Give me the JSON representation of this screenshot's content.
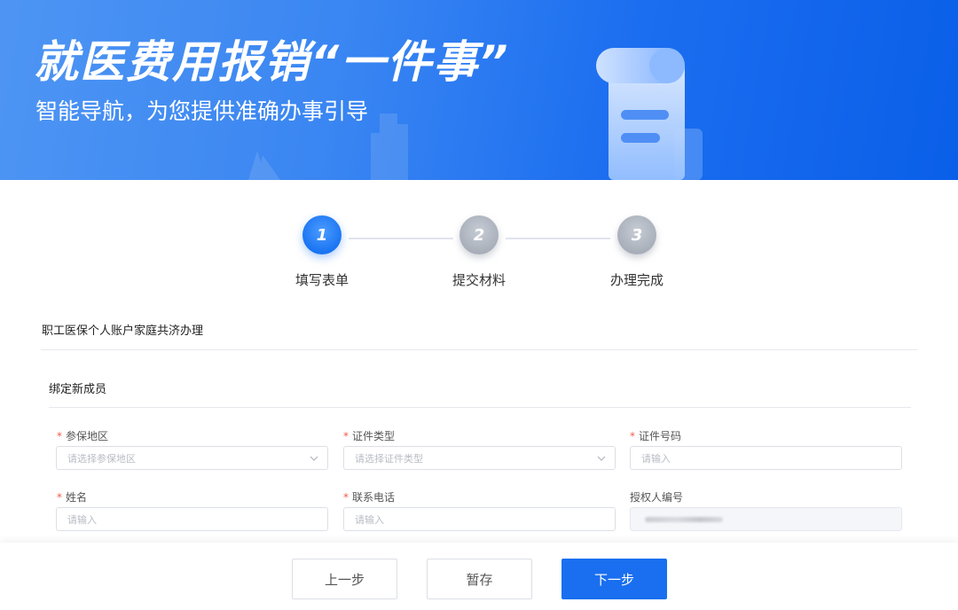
{
  "banner": {
    "title": "就医费用报销“一件事”",
    "subtitle": "智能导航，为您提供准确办事引导"
  },
  "steps": [
    {
      "number": "1",
      "label": "填写表单",
      "state": "active"
    },
    {
      "number": "2",
      "label": "提交材料",
      "state": "inactive"
    },
    {
      "number": "3",
      "label": "办理完成",
      "state": "inactive"
    }
  ],
  "form": {
    "page_title": "职工医保个人账户家庭共济办理",
    "section_title": "绑定新成员",
    "fields": {
      "region": {
        "label": "参保地区",
        "required": true,
        "placeholder": "请选择参保地区"
      },
      "id_type": {
        "label": "证件类型",
        "required": true,
        "placeholder": "请选择证件类型"
      },
      "id_number": {
        "label": "证件号码",
        "required": true,
        "placeholder": "请输入"
      },
      "name": {
        "label": "姓名",
        "required": true,
        "placeholder": "请输入"
      },
      "phone": {
        "label": "联系电话",
        "required": true,
        "placeholder": "请输入"
      },
      "authorizer_id": {
        "label": "授权人编号",
        "required": false
      }
    },
    "required_marker": "*"
  },
  "footer": {
    "prev_label": "上一步",
    "save_label": "暂存",
    "next_label": "下一步"
  },
  "colors": {
    "accent": "#1a6ff0",
    "required": "#f05b4b",
    "inactive_step": "#a6adb8"
  }
}
